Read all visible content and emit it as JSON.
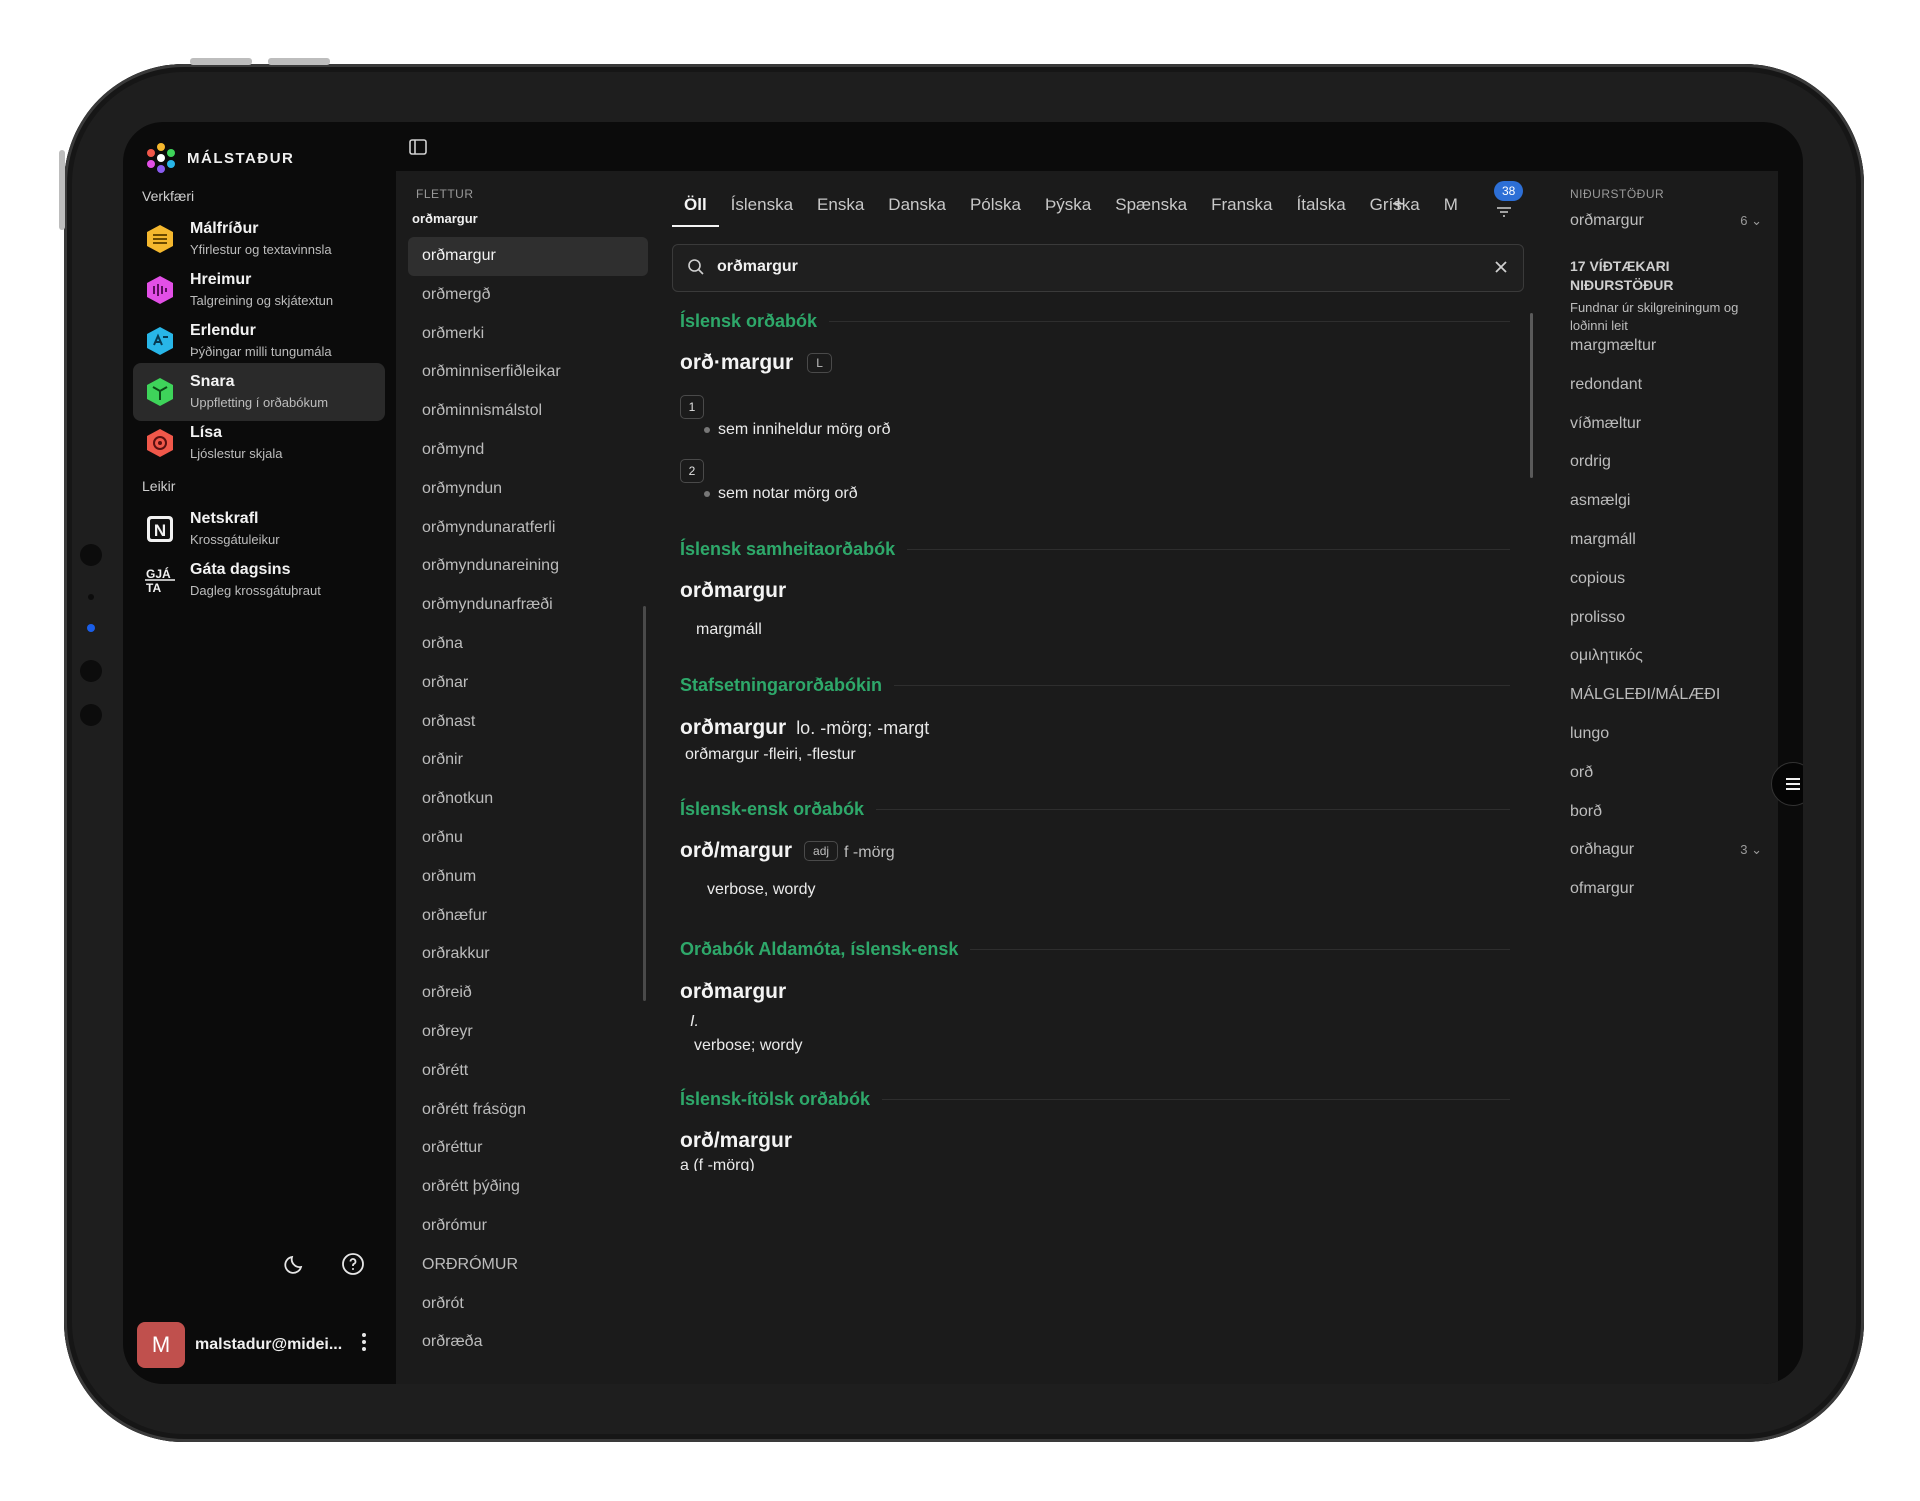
{
  "app": {
    "brand": "MÁLSTAÐUR",
    "tools_label": "Verkfæri",
    "games_label": "Leikir",
    "tools": [
      {
        "title": "Málfríður",
        "subtitle": "Yfirlestur og textavinnsla",
        "icon": "malfridur-icon",
        "color": "#f5b82e"
      },
      {
        "title": "Hreimur",
        "subtitle": "Talgreining og skjátextun",
        "icon": "hreimur-icon",
        "color": "#e24fe6"
      },
      {
        "title": "Erlendur",
        "subtitle": "Þýðingar milli tungumála",
        "icon": "erlendur-icon",
        "color": "#28b6e8"
      },
      {
        "title": "Snara",
        "subtitle": "Uppfletting í orðabókum",
        "icon": "snara-icon",
        "color": "#3ed45a"
      },
      {
        "title": "Lísa",
        "subtitle": "Ljóslestur skjala",
        "icon": "lisa-icon",
        "color": "#f0584a"
      }
    ],
    "games": [
      {
        "title": "Netskrafl",
        "subtitle": "Krossgátuleikur",
        "icon": "netskrafl-icon"
      },
      {
        "title": "Gáta dagsins",
        "subtitle": "Dagleg krossgátuþraut",
        "icon": "gata-icon"
      }
    ],
    "user": {
      "initial": "M",
      "email": "malstadur@midei..."
    }
  },
  "flettur": {
    "header": "FLETTUR",
    "current": "orðmargur",
    "items": [
      "orðmargur",
      "orðmergð",
      "orðmerki",
      "orðminniserfiðleikar",
      "orðminnismálstol",
      "orðmynd",
      "orðmyndun",
      "orðmyndunaratferli",
      "orðmyndunareining",
      "orðmyndunarfræði",
      "orðna",
      "orðnar",
      "orðnast",
      "orðnir",
      "orðnotkun",
      "orðnu",
      "orðnum",
      "orðnæfur",
      "orðrakkur",
      "orðreið",
      "orðreyr",
      "orðrétt",
      "orðrétt frásögn",
      "orðréttur",
      "orðrétt þýðing",
      "orðrómur",
      "ORÐRÓMUR",
      "orðrót",
      "orðræða"
    ]
  },
  "main": {
    "tabs": [
      "Öll",
      "Íslenska",
      "Enska",
      "Danska",
      "Pólska",
      "Þýska",
      "Spænska",
      "Franska",
      "Ítalska",
      "Gríska",
      "M"
    ],
    "badge": "38",
    "search_value": "orðmargur",
    "entries": {
      "d1": {
        "name": "Íslensk orðabók",
        "head": "orð·margur",
        "tag": "L",
        "senses": [
          {
            "num": "1",
            "text": "sem inniheldur mörg orð"
          },
          {
            "num": "2",
            "text": "sem notar mörg orð"
          }
        ]
      },
      "d2": {
        "name": "Íslensk samheitaorðabók",
        "head": "orðmargur",
        "text": "margmáll"
      },
      "d3": {
        "name": "Stafsetningarorðabókin",
        "head": "orðmargur",
        "sub": "lo. -mörg; -margt",
        "text": "orðmargur -fleiri, -flestur"
      },
      "d4": {
        "name": "Íslensk-ensk orðabók",
        "head": "orð/margur",
        "tag": "adj",
        "sub": "f -mörg",
        "text": "verbose, wordy"
      },
      "d5": {
        "name": "Orðabók Aldamóta, íslensk-ensk",
        "head": "orðmargur",
        "roman": "I.",
        "text": "verbose; wordy"
      },
      "d6": {
        "name": "Íslensk-ítölsk orðabók",
        "head": "orð/margur",
        "text": "a (f -mörg)"
      }
    }
  },
  "results": {
    "header": "NIÐURSTÖÐUR",
    "top": {
      "term": "orðmargur",
      "count": "6"
    },
    "more_heading": "17 VÍÐTÆKARI NIÐURSTÖÐUR",
    "more_sub": "Fundnar úr skilgreiningum og loðinni leit",
    "items": [
      {
        "term": "margmæltur"
      },
      {
        "term": "redondant"
      },
      {
        "term": "víðmæltur"
      },
      {
        "term": "ordrig"
      },
      {
        "term": "asmælgi"
      },
      {
        "term": "margmáll"
      },
      {
        "term": "copious"
      },
      {
        "term": "prolisso"
      },
      {
        "term": "ομιλητικός"
      },
      {
        "term": "MÁLGLEÐI/MÁLÆÐI"
      },
      {
        "term": "lungo"
      },
      {
        "term": "orð"
      },
      {
        "term": "borð"
      },
      {
        "term": "orðhagur",
        "count": "3"
      },
      {
        "term": "ofmargur"
      }
    ]
  }
}
